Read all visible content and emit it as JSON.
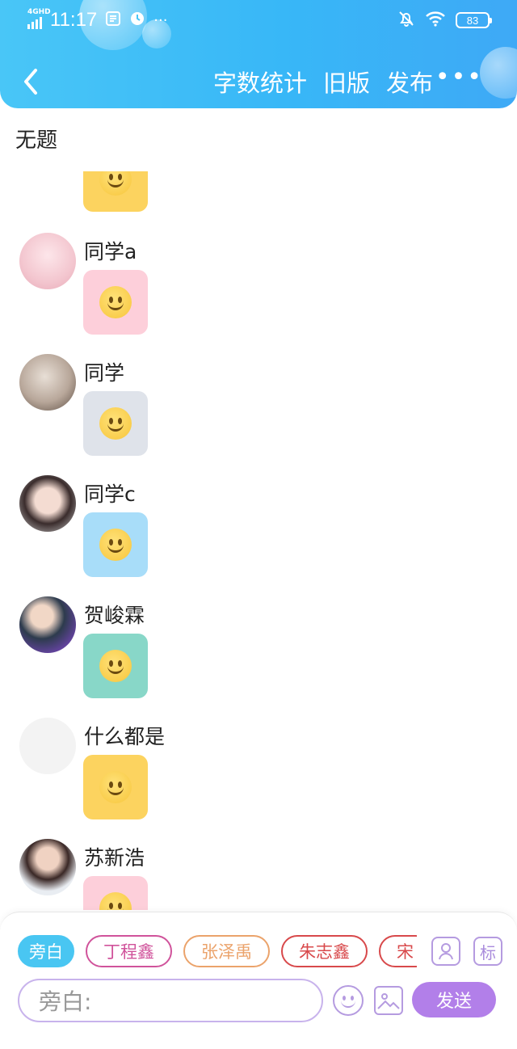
{
  "status_bar": {
    "network": "4GHD",
    "time": "11:17",
    "more": "···",
    "battery": "83"
  },
  "nav": {
    "back_icon": "chevron-left-icon",
    "word_count": "字数统计",
    "old_version": "旧版",
    "publish": "发布",
    "more": "•••"
  },
  "title": "无题",
  "entries": [
    {
      "name": "",
      "bubble_color": "#fcd35f"
    },
    {
      "name": "同学a",
      "bubble_color": "#fdcfda",
      "avatar_color": "#f3c6cf"
    },
    {
      "name": "同学",
      "bubble_color": "#dfe3ea",
      "avatar_color": "#b8a79a"
    },
    {
      "name": "同学c",
      "bubble_color": "#a8ddf9",
      "avatar_color": "#5b4a48"
    },
    {
      "name": "贺峻霖",
      "bubble_color": "#88d7c8",
      "avatar_color": "#3c5b79"
    },
    {
      "name": "什么都是",
      "bubble_color": "#fcd35f",
      "avatar_color": "#f2f2f2"
    },
    {
      "name": "苏新浩",
      "bubble_color": "#fdcfda",
      "avatar_color": "#c99884"
    }
  ],
  "composer": {
    "characters": [
      {
        "label": "旁白",
        "color": "#49c6f2"
      },
      {
        "label": "丁程鑫",
        "color": "#d0539b"
      },
      {
        "label": "张泽禹",
        "color": "#eba36b"
      },
      {
        "label": "朱志鑫",
        "color": "#d8494b"
      },
      {
        "label": "宋",
        "color": "#d8494b"
      }
    ],
    "label_btn": "标",
    "input_placeholder": "旁白:",
    "send_label": "发送",
    "accent_color": "#b27fe9"
  }
}
